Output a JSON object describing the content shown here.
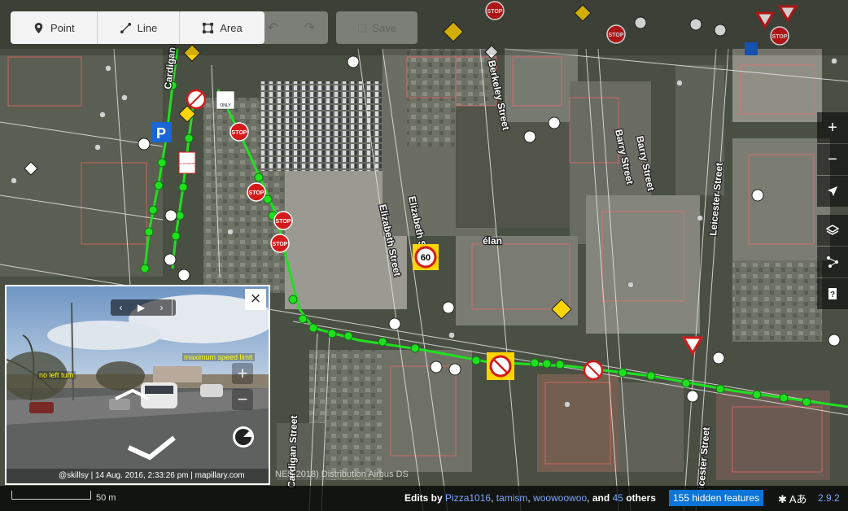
{
  "toolbar": {
    "point_label": "Point",
    "line_label": "Line",
    "area_label": "Area",
    "undo_icon": "undo-icon",
    "redo_icon": "redo-icon",
    "save_label": "Save"
  },
  "map": {
    "streets": [
      "Berkeley Street",
      "Elizabeth Street",
      "Elizabeth Street",
      "Barry Street",
      "Barry Street",
      "Leicester Street",
      "Leicester Street",
      "Cardigan Street",
      "Cardigan Street"
    ],
    "place_label": "élan",
    "speed_sign": "60",
    "sign_labels": [
      "STOP",
      "STOP",
      "STOP",
      "STOP",
      "STOP",
      "STOP",
      "STOP"
    ],
    "parking_label": "P",
    "no_stopping_label": "NO STOPPING",
    "only_label": "ONLY",
    "colors": {
      "route": "#1fe01f",
      "building_outline": "#ff6a6a",
      "road_line": "#e6e6e6"
    }
  },
  "viewer": {
    "close_label": "×",
    "nav_prev": "‹",
    "nav_play": "▶",
    "nav_next": "›",
    "zoom_in": "+",
    "zoom_out": "−",
    "label_left": "no left turn",
    "label_right": "maximum speed limit",
    "attribution": "@skillsy | 14 Aug. 2016, 2:33:26 pm | mapillary.com"
  },
  "imagery_attribution": "NES 2018) Distribution Airbus DS",
  "controls": {
    "zoom_in": "+",
    "zoom_out": "−",
    "icons": [
      "locate-icon",
      "layers-icon",
      "map-data-icon",
      "help-icon"
    ]
  },
  "footer": {
    "scale_label": "50 m",
    "edits_by": "Edits by",
    "contributors": [
      "Pizza1016",
      "tamism",
      "woowoowoo"
    ],
    "and": "and",
    "others_count": "45",
    "others": "others",
    "hidden_features": "155 hidden features",
    "issues_icon": "bug-icon",
    "translate_label": "Aあ",
    "version": "2.9.2"
  }
}
